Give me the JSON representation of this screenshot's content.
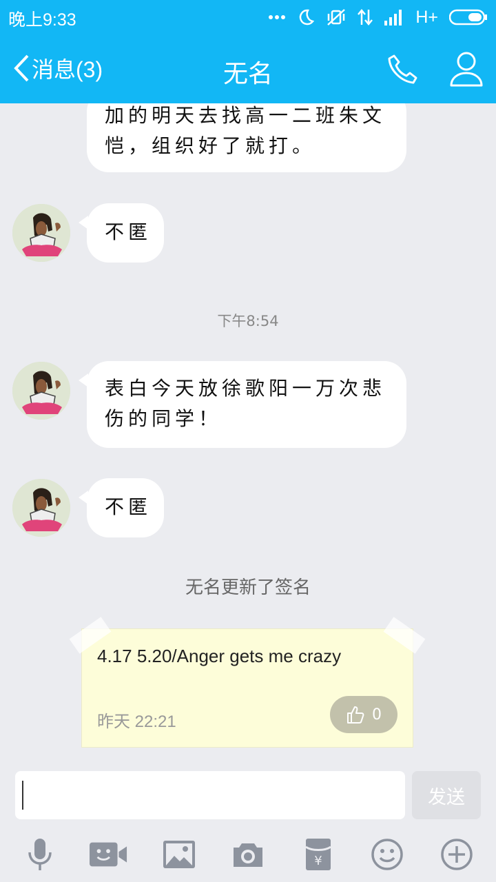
{
  "status_bar": {
    "time": "晚上9:33",
    "network": "H+"
  },
  "header": {
    "back_label": "消息(3)",
    "title": "无名"
  },
  "messages": [
    {
      "type": "received",
      "text": "加的明天去找高一二班朱文恺，组织好了就打。"
    },
    {
      "type": "received",
      "text": "不匿"
    },
    {
      "type": "timestamp",
      "text": "下午8:54"
    },
    {
      "type": "received",
      "text": "表白今天放徐歌阳一万次悲伤的同学！"
    },
    {
      "type": "received",
      "text": "不匿"
    }
  ],
  "notice": "无名更新了签名",
  "signature_card": {
    "text": "4.17 5.20/Anger gets me crazy",
    "date": "昨天 22:21",
    "likes": "0"
  },
  "input": {
    "value": "",
    "send_label": "发送"
  },
  "toolbar": {
    "icons": [
      "microphone-icon",
      "video-icon",
      "image-icon",
      "camera-icon",
      "red-packet-icon",
      "emoji-icon",
      "plus-icon"
    ]
  },
  "colors": {
    "header": "#12b7f5",
    "background": "#ebecf0",
    "bubble": "#ffffff",
    "card": "#fdfdd9"
  }
}
